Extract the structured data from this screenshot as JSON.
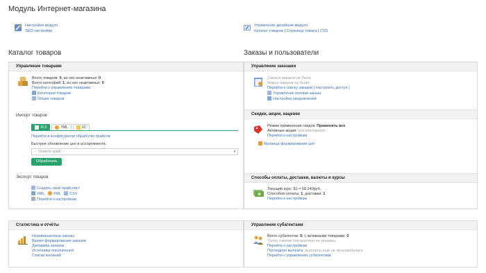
{
  "page_title": "Модуль Интернет-магазина",
  "top_links": {
    "left": {
      "link1": "Настройки модуля",
      "link2": "SEO настройки"
    },
    "right": {
      "link1": "Управление дизайном модуля",
      "link2": "Каталог товаров",
      "sep1": " | ",
      "link3": "Страница товара",
      "sep2": " | ",
      "link4": "CSS"
    }
  },
  "catalog_title": "Каталог товаров",
  "orders_title": "Заказы и пользователи",
  "products": {
    "header": "Управление товарами",
    "total_label": "Всего товаров: ",
    "total": "0",
    "inactive_label": ", из них неактивных: ",
    "inactive": "0",
    "cats_label": "Всего категорий: ",
    "cats": "1",
    "cats_inactive_label": ", из них неактивных: ",
    "cats_inactive": "0",
    "go_link": "Перейти к управлению товарами",
    "cat_link": "Категории товаров",
    "options_link": "Опции товаров",
    "import_title": "Импорт товаров",
    "tabs": [
      "XLS",
      "YML",
      "1C"
    ],
    "configurator_link": "Перейти в конфигуратор обработки прайсов",
    "quick_update": "Быстрое обновление цен и ассортимента:",
    "select_placeholder": "-- Укажите прайс --",
    "process_button": "Обработать",
    "export_title": "Экспорт товаров",
    "create_price_link": "Создать свой прайслист",
    "xml_link": "XML",
    "yml_link": "YML",
    "csv_link": "CSV",
    "export_settings_link": "Перейти к настройкам"
  },
  "orders": {
    "header": "Управление заказами",
    "line1": "Свежих заказов не было",
    "line2": "Новых заказов не было",
    "go_link": "Перейти к списку заказов",
    "setup_link": "[ Настроить доступ ]",
    "fields_link": "Управление полями заказа",
    "notify_link": "Настройка уведомлений"
  },
  "discounts": {
    "header": "Скидки, акции, наценки",
    "mode_label": "Режим применения скидок: ",
    "mode": "Применять все",
    "active_label": "Активные акции: ",
    "active": "отсутствуют",
    "settings_link": "Перейти к настройкам",
    "matrix_link": "Матрица формирования цен"
  },
  "payments": {
    "header": "Способы оплаты, доставки, валюты и курсы",
    "rate_label": "Текущий курс: ",
    "rate": "$1 = 58.240руб.",
    "methods_label": "Способов оплаты: ",
    "pay_count": "1",
    "delivery_label": ", доставки: ",
    "delivery_count": "1",
    "settings_link": "Перейти к настройкам"
  },
  "stats": {
    "header": "Статистика и отчёты",
    "links": [
      "Незавершенные заказы",
      "Время формирования заказов",
      "Динамика заказов",
      "Источники покупателей",
      "Списки желаний"
    ]
  },
  "subagents": {
    "header": "Управление субагентами",
    "total_label": "Всего субагентов: ",
    "total": "5",
    "active_label": ", с активными товарами: ",
    "active": "0",
    "grey1": "Тоты счетов для выплат не указаны",
    "settings_link": "Перейти к настройкам",
    "grey2_link": "Последняя выплата",
    "grey2": ": выплата ещё не производилась",
    "manage_link": "Перейти к управлению субагентами"
  },
  "colors": {
    "accent": "#2aa36b",
    "link": "#3a6fb0",
    "panel_header": "#f2f2f2"
  }
}
